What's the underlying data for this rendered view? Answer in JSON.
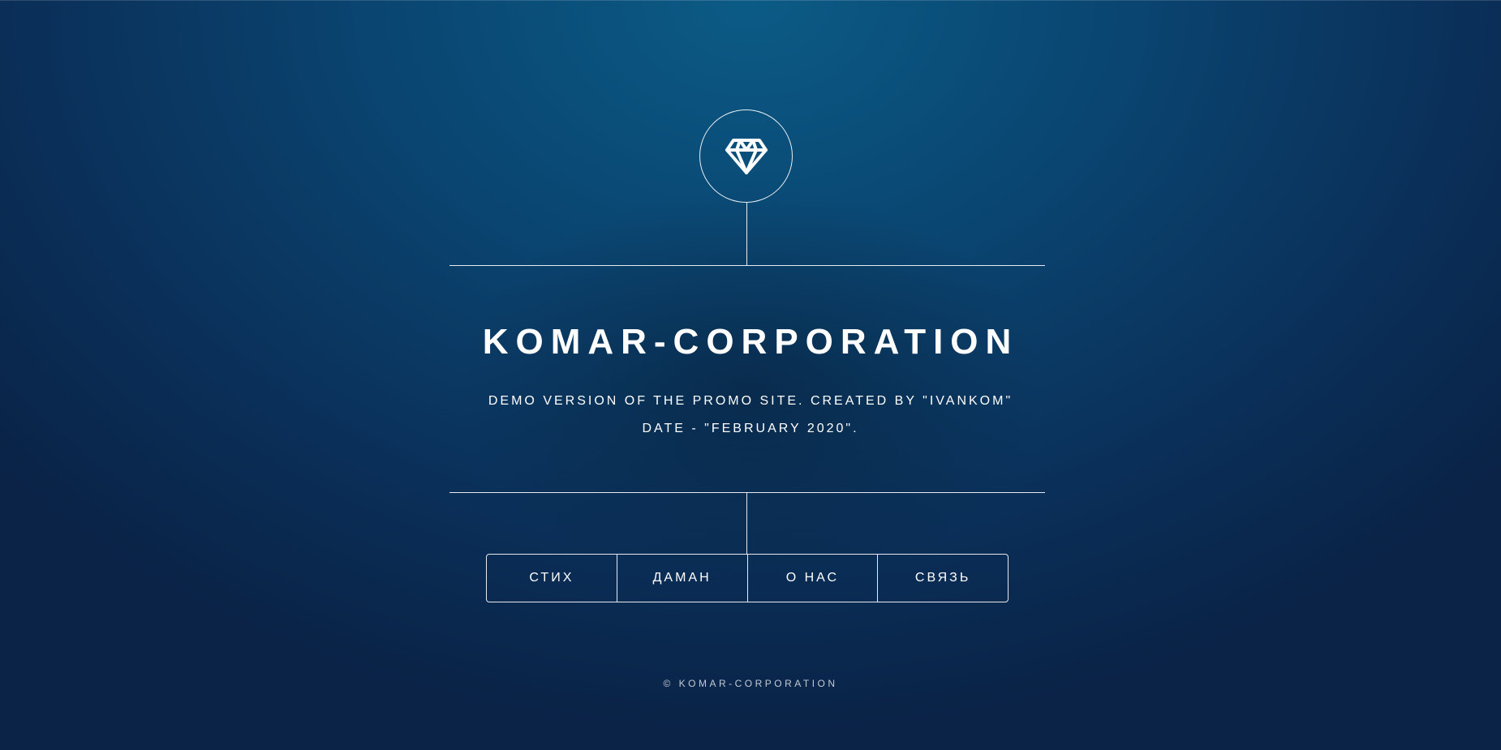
{
  "header": {
    "logo_icon": "diamond-icon"
  },
  "main": {
    "title": "KOMAR-CORPORATION",
    "subtitle_line1": "DEMO VERSION OF THE PROMO SITE. CREATED BY \"IVANKOM\"",
    "subtitle_line2": "DATE - \"FEBRUARY 2020\"."
  },
  "nav": {
    "items": [
      {
        "label": "СТИХ"
      },
      {
        "label": "ДАМАН"
      },
      {
        "label": "О НАС"
      },
      {
        "label": "СВЯЗЬ"
      }
    ]
  },
  "footer": {
    "copyright": "© KOMAR-CORPORATION"
  },
  "colors": {
    "background_top": "#0b5b86",
    "background_bottom": "#0a2347",
    "foreground": "#ffffff"
  }
}
